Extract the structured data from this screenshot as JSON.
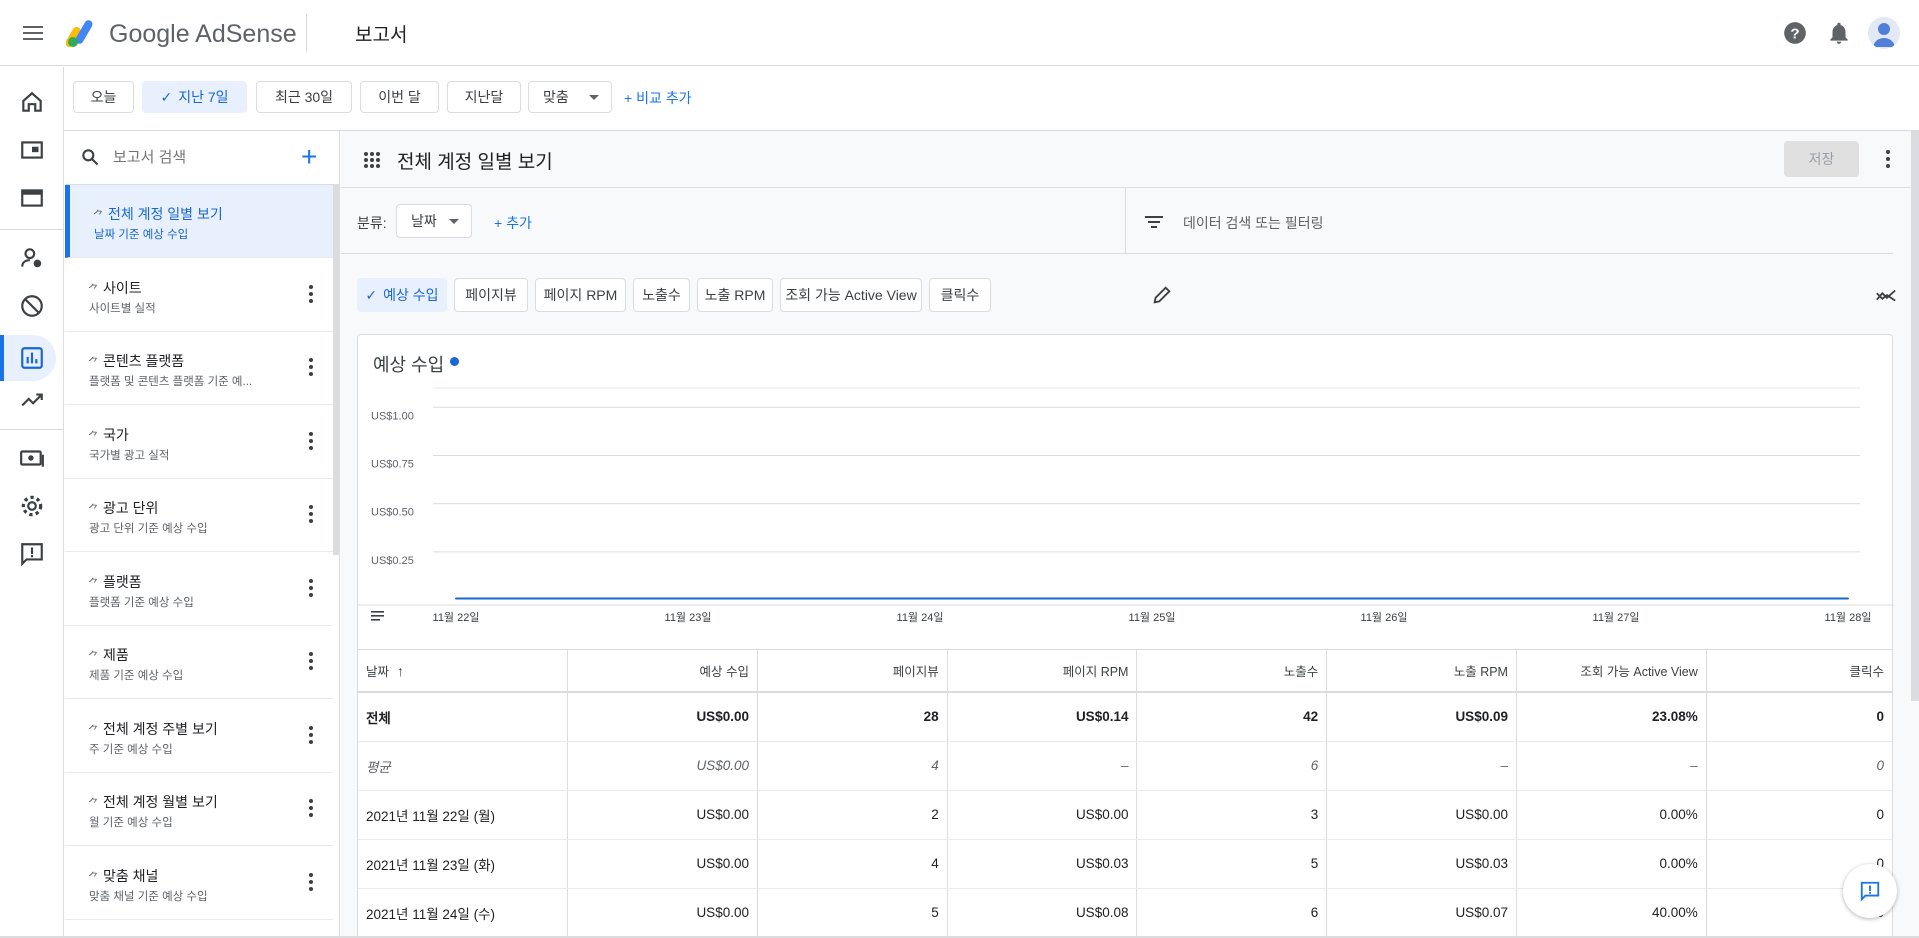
{
  "app": {
    "brand": "Google AdSense",
    "page_title": "보고서"
  },
  "date_presets": [
    {
      "label": "오늘",
      "selected": false
    },
    {
      "label": "지난 7일",
      "selected": true
    },
    {
      "label": "최근 30일",
      "selected": false
    },
    {
      "label": "이번 달",
      "selected": false
    },
    {
      "label": "지난달",
      "selected": false
    },
    {
      "label": "맞춤",
      "selected": false
    }
  ],
  "add_compare_label": "+ 비교 추가",
  "sidebar": {
    "search_placeholder": "보고서 검색",
    "reports": [
      {
        "title": "전체 계정 일별 보기",
        "subtitle": "날짜 기준 예상 수입",
        "active": true
      },
      {
        "title": "사이트",
        "subtitle": "사이트별 실적",
        "active": false
      },
      {
        "title": "콘텐츠 플랫폼",
        "subtitle": "플랫폼 및 콘텐츠 플랫폼 기준 예...",
        "active": false
      },
      {
        "title": "국가",
        "subtitle": "국가별 광고 실적",
        "active": false
      },
      {
        "title": "광고 단위",
        "subtitle": "광고 단위 기준 예상 수입",
        "active": false
      },
      {
        "title": "플랫폼",
        "subtitle": "플랫폼 기준 예상 수입",
        "active": false
      },
      {
        "title": "제품",
        "subtitle": "제품 기준 예상 수입",
        "active": false
      },
      {
        "title": "전체 계정 주별 보기",
        "subtitle": "주 기준 예상 수입",
        "active": false
      },
      {
        "title": "전체 계정 월별 보기",
        "subtitle": "월 기준 예상 수입",
        "active": false
      },
      {
        "title": "맞춤 채널",
        "subtitle": "맞춤 채널 기준 예상 수입",
        "active": false
      }
    ]
  },
  "report": {
    "title": "전체 계정 일별 보기",
    "save_label": "저장",
    "breakdown_label": "분류:",
    "breakdown_value": "날짜",
    "add_label": "+ 추가",
    "filter_placeholder": "데이터 검색 또는 필터링"
  },
  "metric_chips": [
    {
      "label": "예상 수입",
      "selected": true
    },
    {
      "label": "페이지뷰",
      "selected": false
    },
    {
      "label": "페이지 RPM",
      "selected": false
    },
    {
      "label": "노출수",
      "selected": false
    },
    {
      "label": "노출 RPM",
      "selected": false
    },
    {
      "label": "조회 가능 Active View",
      "selected": false
    },
    {
      "label": "클릭수",
      "selected": false
    }
  ],
  "chart_data": {
    "type": "line",
    "title": "예상 수입",
    "categories": [
      "11월 22일",
      "11월 23일",
      "11월 24일",
      "11월 25일",
      "11월 26일",
      "11월 27일",
      "11월 28일"
    ],
    "series": [
      {
        "name": "예상 수입",
        "values": [
          0,
          0,
          0,
          0,
          0,
          0,
          0
        ],
        "color": "#1967d2"
      }
    ],
    "y_ticks": [
      "US$0.25",
      "US$0.50",
      "US$0.75",
      "US$1.00"
    ],
    "ylim": [
      0,
      1.1
    ],
    "grid": true
  },
  "table": {
    "headers": [
      "날짜",
      "예상 수입",
      "페이지뷰",
      "페이지 RPM",
      "노출수",
      "노출 RPM",
      "조회 가능 Active View",
      "클릭수"
    ],
    "rows": [
      [
        "전체",
        "US$0.00",
        "28",
        "US$0.14",
        "42",
        "US$0.09",
        "23.08%",
        "0"
      ],
      [
        "평균",
        "US$0.00",
        "4",
        "–",
        "6",
        "–",
        "–",
        "0"
      ],
      [
        "2021년 11월 22일 (월)",
        "US$0.00",
        "2",
        "US$0.00",
        "3",
        "US$0.00",
        "0.00%",
        "0"
      ],
      [
        "2021년 11월 23일 (화)",
        "US$0.00",
        "4",
        "US$0.03",
        "5",
        "US$0.03",
        "0.00%",
        "0"
      ],
      [
        "2021년 11월 24일 (수)",
        "US$0.00",
        "5",
        "US$0.08",
        "6",
        "US$0.07",
        "40.00%",
        "0"
      ]
    ]
  },
  "colors": {
    "accent": "#1a73e8",
    "selected_bg": "#e8f0fe"
  }
}
